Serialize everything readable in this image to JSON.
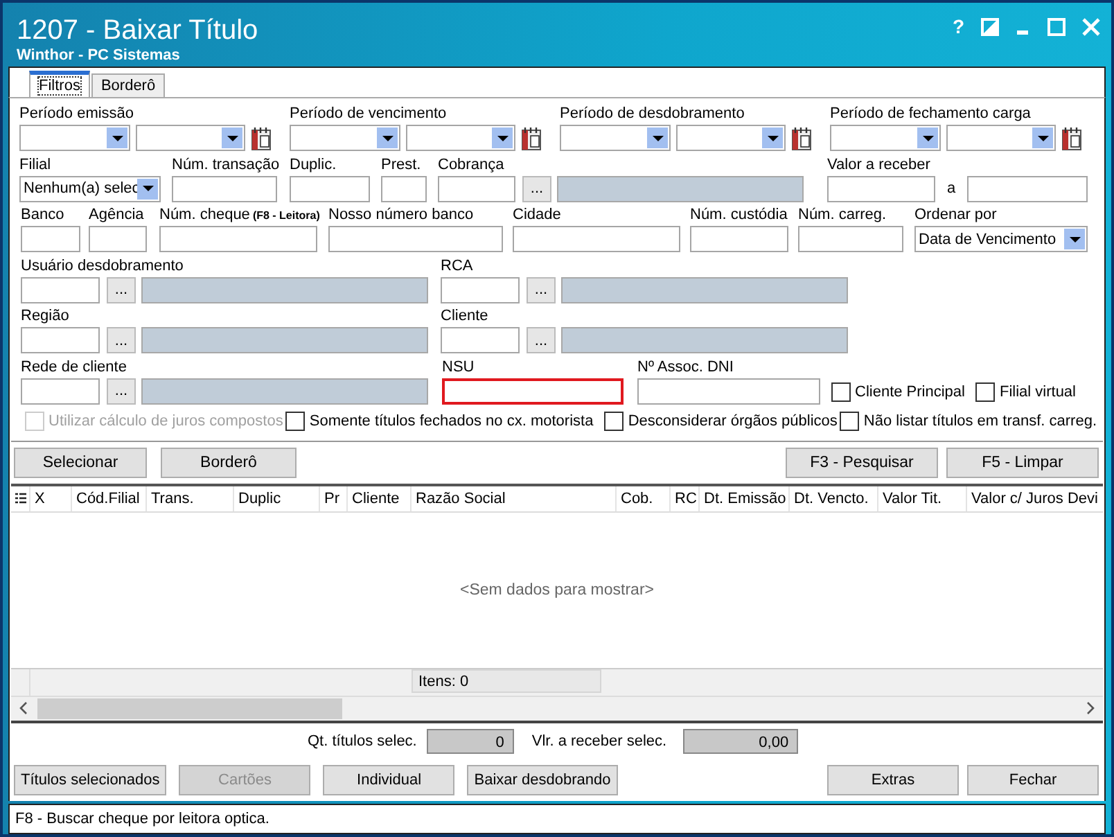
{
  "window": {
    "title": "1207 - Baixar Título",
    "subtitle": "Winthor - PC Sistemas",
    "help": "?"
  },
  "tabs": [
    {
      "label": "Filtros",
      "selected": true
    },
    {
      "label": "Borderô",
      "selected": false
    }
  ],
  "rows": [
    [
      {
        "kind": "period",
        "label": "Período emissão"
      },
      {
        "kind": "period",
        "label": "Período de vencimento"
      },
      {
        "kind": "period",
        "label": "Período de desdobramento"
      },
      {
        "kind": "period",
        "label": "Período de fechamento carga"
      }
    ],
    [
      {
        "kind": "combo",
        "label": "Filial",
        "value": "Nenhum(a) selec"
      },
      {
        "kind": "text",
        "label": "Núm. transação",
        "highlighted": false
      },
      {
        "kind": "text",
        "label": "Duplic.",
        "highlighted": false
      },
      {
        "kind": "text",
        "label": "Prest.",
        "highlighted": false
      },
      {
        "kind": "lookup",
        "label": "Cobrança",
        "button": "..."
      },
      {
        "kind": "range",
        "label": "Valor a receber",
        "separator": "a"
      }
    ],
    [
      {
        "kind": "text",
        "label": "Banco",
        "highlighted": false
      },
      {
        "kind": "text",
        "label": "Agência",
        "highlighted": false
      },
      {
        "kind": "text",
        "label": "Núm. cheque",
        "hint": "(F8 - Leitora)",
        "highlighted": false
      },
      {
        "kind": "text",
        "label": "Nosso número banco",
        "highlighted": false
      },
      {
        "kind": "text",
        "label": "Cidade",
        "highlighted": false
      },
      {
        "kind": "text",
        "label": "Núm. custódia",
        "highlighted": false
      },
      {
        "kind": "text",
        "label": "Núm. carreg.",
        "highlighted": false
      },
      {
        "kind": "combo",
        "label": "Ordenar por",
        "value": "Data de Vencimento"
      }
    ],
    [
      {
        "kind": "lookup",
        "label": "Usuário desdobramento",
        "button": "..."
      },
      {
        "kind": "lookup",
        "label": "RCA",
        "button": "..."
      }
    ],
    [
      {
        "kind": "lookup",
        "label": "Região",
        "button": "..."
      },
      {
        "kind": "lookup",
        "label": "Cliente",
        "button": "..."
      }
    ],
    [
      {
        "kind": "lookup",
        "label": "Rede de cliente",
        "button": "..."
      },
      {
        "kind": "text",
        "label": "NSU",
        "highlighted": true
      },
      {
        "kind": "text",
        "label": "Nº Assoc. DNI",
        "highlighted": false
      },
      {
        "kind": "check",
        "label": "Cliente Principal",
        "checked": false,
        "disabled": false
      },
      {
        "kind": "check",
        "label": "Filial virtual",
        "checked": false,
        "disabled": false
      }
    ],
    [
      {
        "kind": "check",
        "label": "Utilizar cálculo de juros compostos",
        "checked": false,
        "disabled": true
      },
      {
        "kind": "check",
        "label": "Somente títulos fechados no cx. motorista",
        "checked": false,
        "disabled": false
      },
      {
        "kind": "check",
        "label": "Desconsiderar órgãos públicos",
        "checked": false,
        "disabled": false
      },
      {
        "kind": "check",
        "label": "Não listar títulos em transf. carreg.",
        "checked": false,
        "disabled": false
      }
    ]
  ],
  "filter_buttons": {
    "left": [
      "Selecionar",
      "Borderô"
    ],
    "right": [
      "F3 - Pesquisar",
      "F5 - Limpar"
    ]
  },
  "grid": {
    "columns": [
      "X",
      "Cód.Filial",
      "Trans.",
      "Duplic",
      "Pr",
      "Cliente",
      "Razão Social",
      "Cob.",
      "RC",
      "Dt. Emissão",
      "Dt. Vencto.",
      "Valor Tit.",
      "Valor c/ Juros Devi"
    ],
    "empty_text": "<Sem dados para mostrar>",
    "footer": "Itens: 0"
  },
  "totals": [
    {
      "label": "Qt. títulos selec.",
      "value": "0"
    },
    {
      "label": "Vlr. a receber selec.",
      "value": "0,00"
    }
  ],
  "bottom_buttons": {
    "left": [
      {
        "label": "Títulos selecionados",
        "disabled": false
      },
      {
        "label": "Cartões",
        "disabled": true
      },
      {
        "label": "Individual",
        "disabled": false
      },
      {
        "label": "Baixar desdobrando",
        "disabled": false
      }
    ],
    "right": [
      {
        "label": "Extras",
        "disabled": false
      },
      {
        "label": "Fechar",
        "disabled": false
      }
    ]
  },
  "status_bar": "F8 - Buscar cheque por leitora optica."
}
